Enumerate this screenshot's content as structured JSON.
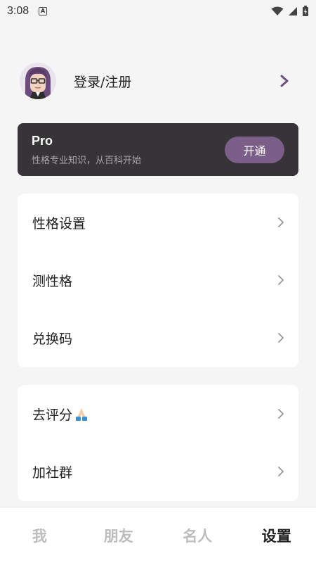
{
  "status_bar": {
    "time": "3:08",
    "badge": "A"
  },
  "profile": {
    "name": "登录/注册",
    "avatar_icon": "avatar-glasses-icon"
  },
  "pro": {
    "title": "Pro",
    "subtitle": "性格专业知识，从百科开始",
    "button": "开通"
  },
  "menu_group_1": [
    {
      "label": "性格设置"
    },
    {
      "label": "测性格"
    },
    {
      "label": "兑换码"
    }
  ],
  "menu_group_2": [
    {
      "label": "去评分"
    },
    {
      "label": "加社群"
    }
  ],
  "nav": {
    "tabs": [
      {
        "label": "我"
      },
      {
        "label": "朋友"
      },
      {
        "label": "名人"
      },
      {
        "label": "设置"
      }
    ],
    "active": "设置"
  },
  "colors": {
    "accent": "#7c5f88",
    "pro_card_bg": "#363436",
    "chevron_purple": "#6e4f82"
  }
}
